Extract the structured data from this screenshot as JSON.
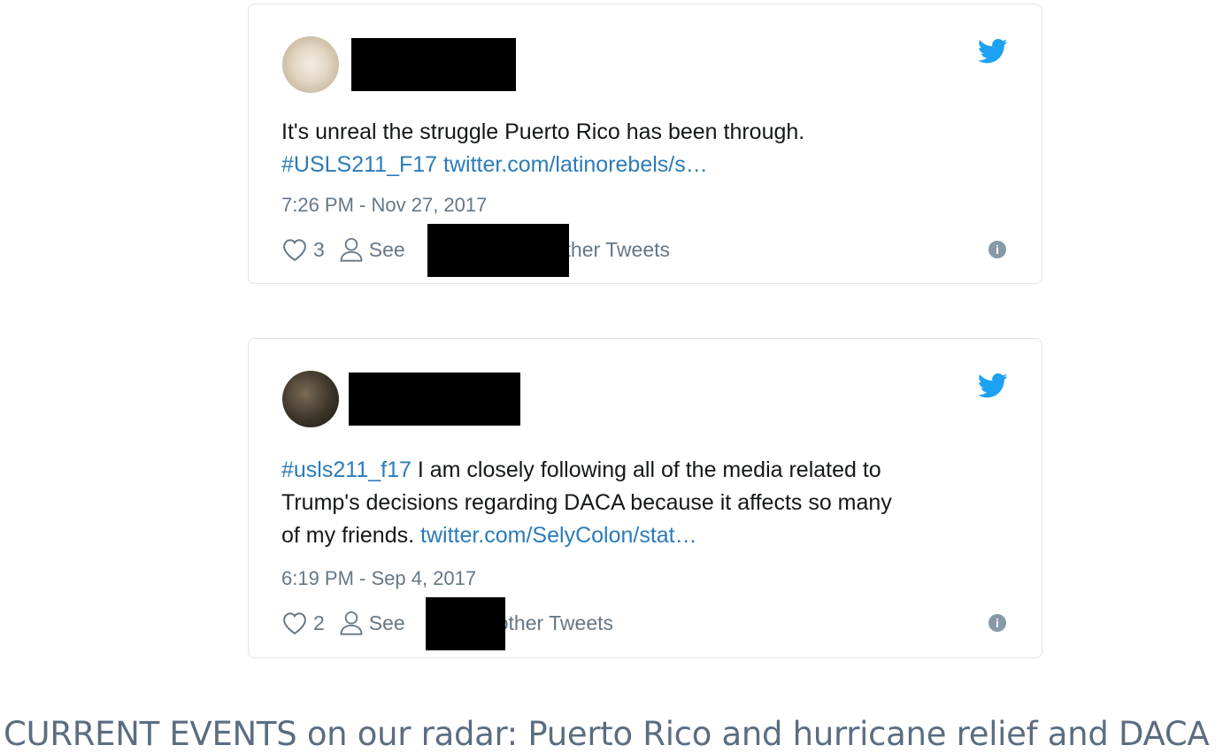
{
  "tweets": [
    {
      "body_text": "It's unreal the struggle Puerto Rico has been through.",
      "hashtag": "#USLS211_F17",
      "link": "twitter.com/latinorebels/s…",
      "timestamp": "7:26 PM - Nov 27, 2017",
      "likes": "3",
      "see_label": "See",
      "see_suffix": "other Tweets"
    },
    {
      "hashtag": "#usls211_f17",
      "body_line1": "I am closely following all of the media related to",
      "body_line2": "Trump's decisions regarding DACA because it affects so many",
      "body_line3": "of my friends.",
      "link": "twitter.com/SelyColon/stat…",
      "timestamp": "6:19 PM - Sep 4, 2017",
      "likes": "2",
      "see_label": "See",
      "see_suffix": "other Tweets"
    }
  ],
  "caption": "CURRENT EVENTS on our radar: Puerto Rico and hurricane relief and DACA",
  "colors": {
    "link": "#2b7bb9",
    "twitter_blue": "#1da1f2",
    "meta": "#657786",
    "caption": "#5b6d80"
  },
  "icons": [
    "twitter-bird-icon",
    "heart-icon",
    "person-icon",
    "info-icon"
  ]
}
